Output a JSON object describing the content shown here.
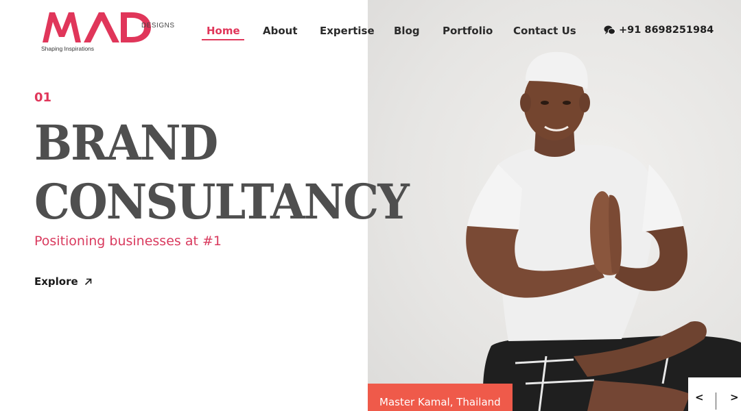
{
  "brand": {
    "logo_text": "MAD",
    "logo_suffix": "DESIGNS",
    "tagline": "Shaping Inspirations",
    "accent_color": "#e0365a"
  },
  "nav": {
    "items": [
      {
        "label": "Home",
        "active": true
      },
      {
        "label": "About",
        "active": false
      },
      {
        "label": "Expertise",
        "active": false
      },
      {
        "label": "Blog",
        "active": false
      },
      {
        "label": "Portfolio",
        "active": false
      },
      {
        "label": "Contact Us",
        "active": false
      }
    ],
    "phone": "+91 8698251984",
    "phone_icon": "wechat-icon"
  },
  "hero": {
    "number": "01",
    "title_line1": "BRAND",
    "title_line2": "CONSULTANCY",
    "subtitle": "Positioning businesses at #1",
    "cta_label": "Explore",
    "cta_icon": "arrow-up-right-icon"
  },
  "slide": {
    "caption": "Master Kamal, Thailand",
    "caption_color": "#ef5a4a",
    "prev_label": "<",
    "next_label": ">"
  }
}
